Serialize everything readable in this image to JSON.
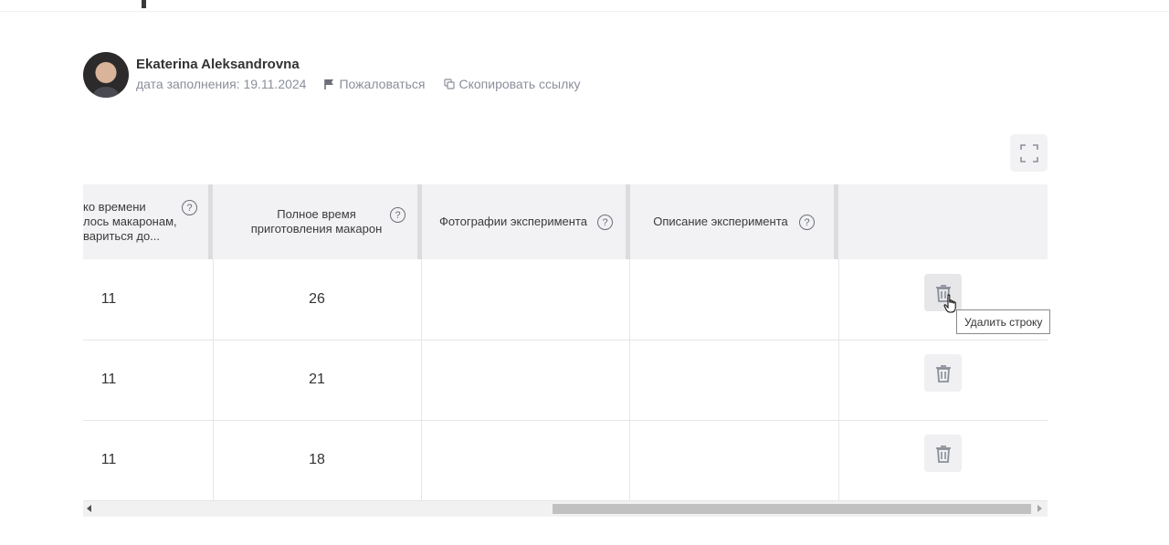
{
  "author": {
    "name": "Ekaterina Aleksandrovna",
    "date_label": "дата заполнения: 19.11.2024",
    "report_label": "Пожаловаться",
    "copy_link_label": "Скопировать ссылку"
  },
  "icons": {
    "avatar": "avatar",
    "report": "flag-icon",
    "copy": "copy-icon",
    "expand": "fullscreen-icon",
    "help": "question-icon",
    "delete": "trash-icon",
    "cursor": "hand-cursor-icon"
  },
  "help_mark": "?",
  "table": {
    "columns": [
      {
        "label_lines": [
          "ко времени",
          "лось макаронам,",
          "вариться до..."
        ]
      },
      {
        "label_lines": [
          "Полное время",
          "приготовления макарон"
        ]
      },
      {
        "label_lines": [
          "Фотографии эксперимента"
        ]
      },
      {
        "label_lines": [
          "Описание эксперимента"
        ]
      },
      {
        "label_lines": [
          ""
        ]
      }
    ],
    "rows": [
      {
        "col1": "11",
        "col2": "26",
        "photos": "",
        "description": ""
      },
      {
        "col1": "11",
        "col2": "21",
        "photos": "",
        "description": ""
      },
      {
        "col1": "11",
        "col2": "18",
        "photos": "",
        "description": ""
      }
    ]
  },
  "tooltip": "Удалить строку",
  "colors": {
    "header_bg": "#f2f2f4",
    "muted_text": "#8b8f9a",
    "button_bg": "#f0f0f2"
  }
}
